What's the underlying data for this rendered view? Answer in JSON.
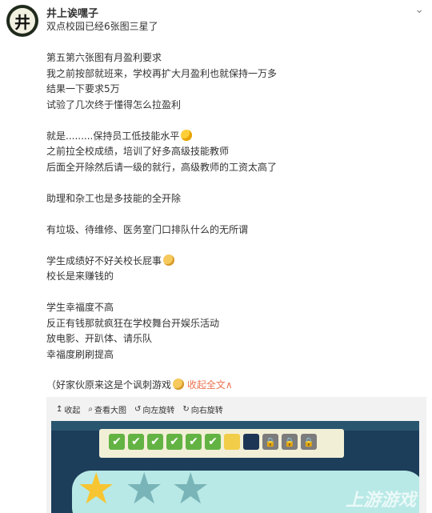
{
  "user": {
    "name": "井上诶嘿子",
    "avatar_char": "井"
  },
  "post": {
    "lines": [
      "双点校园已经6张图三星了",
      "",
      "第五第六张图有月盈利要求",
      "我之前按部就班来，学校再扩大月盈利也就保持一万多",
      "结果一下要求5万",
      "试验了几次终于懂得怎么拉盈利",
      "",
      "就是.........保持员工低技能水平",
      "之前拉全校成绩，培训了好多高级技能教师",
      "后面全开除然后请一级的就行，高级教师的工资太高了",
      "",
      "助理和杂工也是多技能的全开除",
      "",
      "有垃圾、待维修、医务室门口排队什么的无所谓",
      "",
      "学生成绩好不好关校长屁事",
      "校长是来赚钱的",
      "",
      "学生幸福度不高",
      "反正有钱那就疯狂在学校舞台开娱乐活动",
      "放电影、开趴体、请乐队",
      "幸福度刷刷提高"
    ]
  },
  "footer": {
    "text": "（好家伙原来这是个讽刺游戏",
    "collapse_label": "收起全文"
  },
  "toolbar": {
    "collapse": "收起",
    "view_large": "查看大图",
    "rotate_left": "向左旋转",
    "rotate_right": "向右旋转"
  },
  "game": {
    "checks": 6,
    "stars_filled": 1,
    "stars_total": 3
  },
  "watermark": "上游游戏"
}
